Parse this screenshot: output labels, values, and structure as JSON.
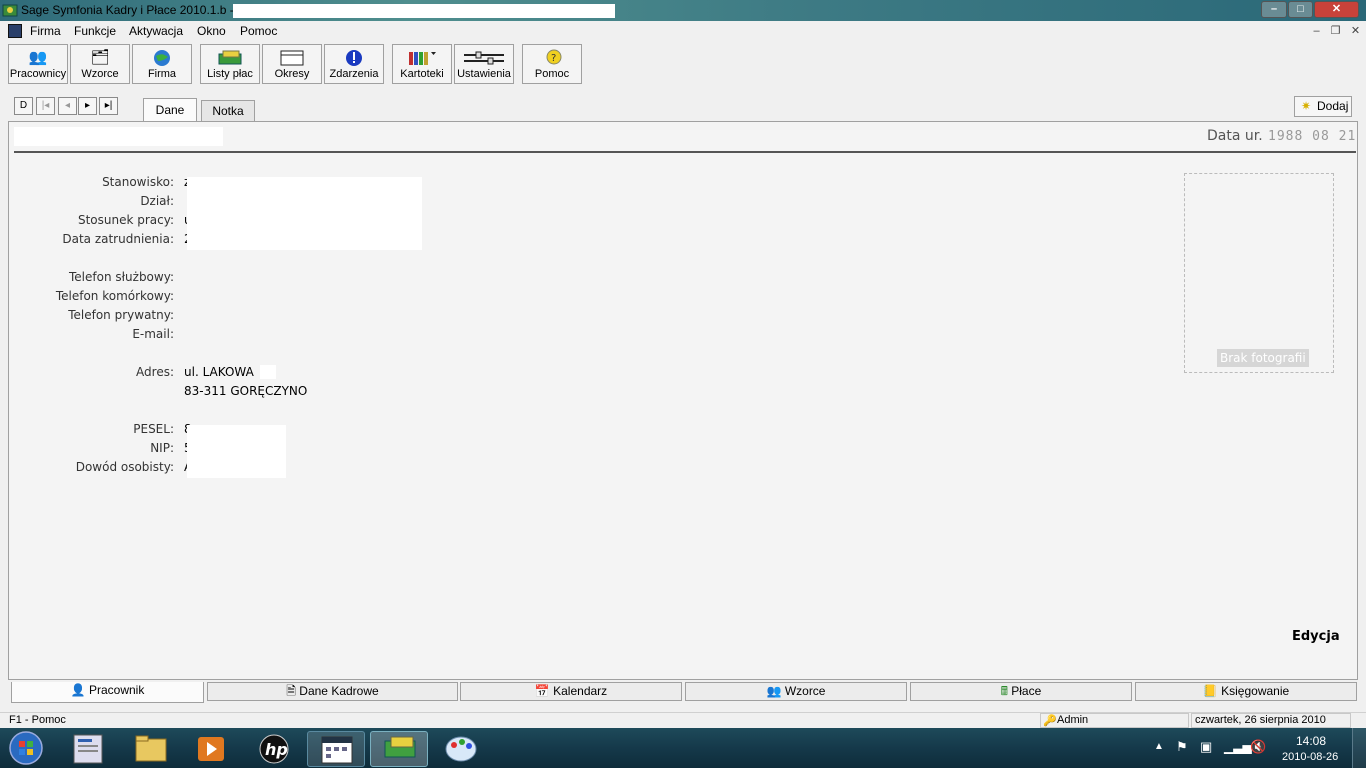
{
  "window": {
    "title": "Sage Symfonia Kadry i Płace 2010.1.b - "
  },
  "window_controls": {
    "minimize": "–",
    "maximize": "□",
    "close": "✕"
  },
  "menu": {
    "items": [
      "Firma",
      "Funkcje",
      "Aktywacja",
      "Okno",
      "Pomoc"
    ],
    "mdi": {
      "minimize": "–",
      "restore": "❐",
      "close": "✕"
    }
  },
  "toolbar": {
    "items": [
      {
        "label": "Pracownicy",
        "icon": "people-icon"
      },
      {
        "label": "Wzorce",
        "icon": "template-icon"
      },
      {
        "label": "Firma",
        "icon": "globe-icon"
      },
      {
        "label": "Listy płac",
        "icon": "money-icon"
      },
      {
        "label": "Okresy",
        "icon": "calendar-icon"
      },
      {
        "label": "Zdarzenia",
        "icon": "alert-icon"
      },
      {
        "label": "Kartoteki",
        "icon": "books-icon"
      },
      {
        "label": "Ustawienia",
        "icon": "sliders-icon"
      },
      {
        "label": "Pomoc",
        "icon": "help-icon"
      }
    ]
  },
  "nav": {
    "first": "D",
    "prev_page": "|◂",
    "prev": "◂",
    "next": "▸",
    "last": "▸|"
  },
  "tabs": [
    {
      "label": "Dane",
      "active": true
    },
    {
      "label": "Notka",
      "active": false
    }
  ],
  "dodaj_button": "Dodaj",
  "header": {
    "birth_label": "Data ur.",
    "birth_value": "1988 08 21"
  },
  "fields": {
    "stanowisko": {
      "label": "Stanowisko:",
      "value": "z"
    },
    "dzial": {
      "label": "Dział:",
      "value": ""
    },
    "stosunek": {
      "label": "Stosunek pracy:",
      "value": "u"
    },
    "data_zatr": {
      "label": "Data zatrudnienia:",
      "value": "2"
    },
    "tel_sluzbowy": {
      "label": "Telefon służbowy:",
      "value": ""
    },
    "tel_komorkowy": {
      "label": "Telefon komórkowy:",
      "value": ""
    },
    "tel_prywatny": {
      "label": "Telefon prywatny:",
      "value": ""
    },
    "email": {
      "label": "E-mail:",
      "value": ""
    },
    "adres": {
      "label": "Adres:",
      "line1": "ul. LAKOWA",
      "line2": "83-311 GORĘCZYNO"
    },
    "pesel": {
      "label": "PESEL:",
      "value": "8"
    },
    "nip": {
      "label": "NIP:",
      "value": "5"
    },
    "dowod": {
      "label": "Dowód osobisty:",
      "value": "A"
    }
  },
  "photo": {
    "placeholder": "Brak fotografii"
  },
  "edycja": "Edycja",
  "bottom_tabs": [
    {
      "label": "Pracownik",
      "icon": "person-icon"
    },
    {
      "label": "Dane Kadrowe",
      "icon": "document-icon"
    },
    {
      "label": "Kalendarz",
      "icon": "calendar-icon"
    },
    {
      "label": "Wzorce",
      "icon": "people-icon"
    },
    {
      "label": "Płace",
      "icon": "calculator-icon"
    },
    {
      "label": "Księgowanie",
      "icon": "ledger-icon"
    }
  ],
  "status": {
    "help": "F1 - Pomoc",
    "user": "Admin",
    "date": "czwartek, 26 sierpnia 2010"
  },
  "taskbar": {
    "time": "14:08",
    "date": "2010-08-26"
  }
}
